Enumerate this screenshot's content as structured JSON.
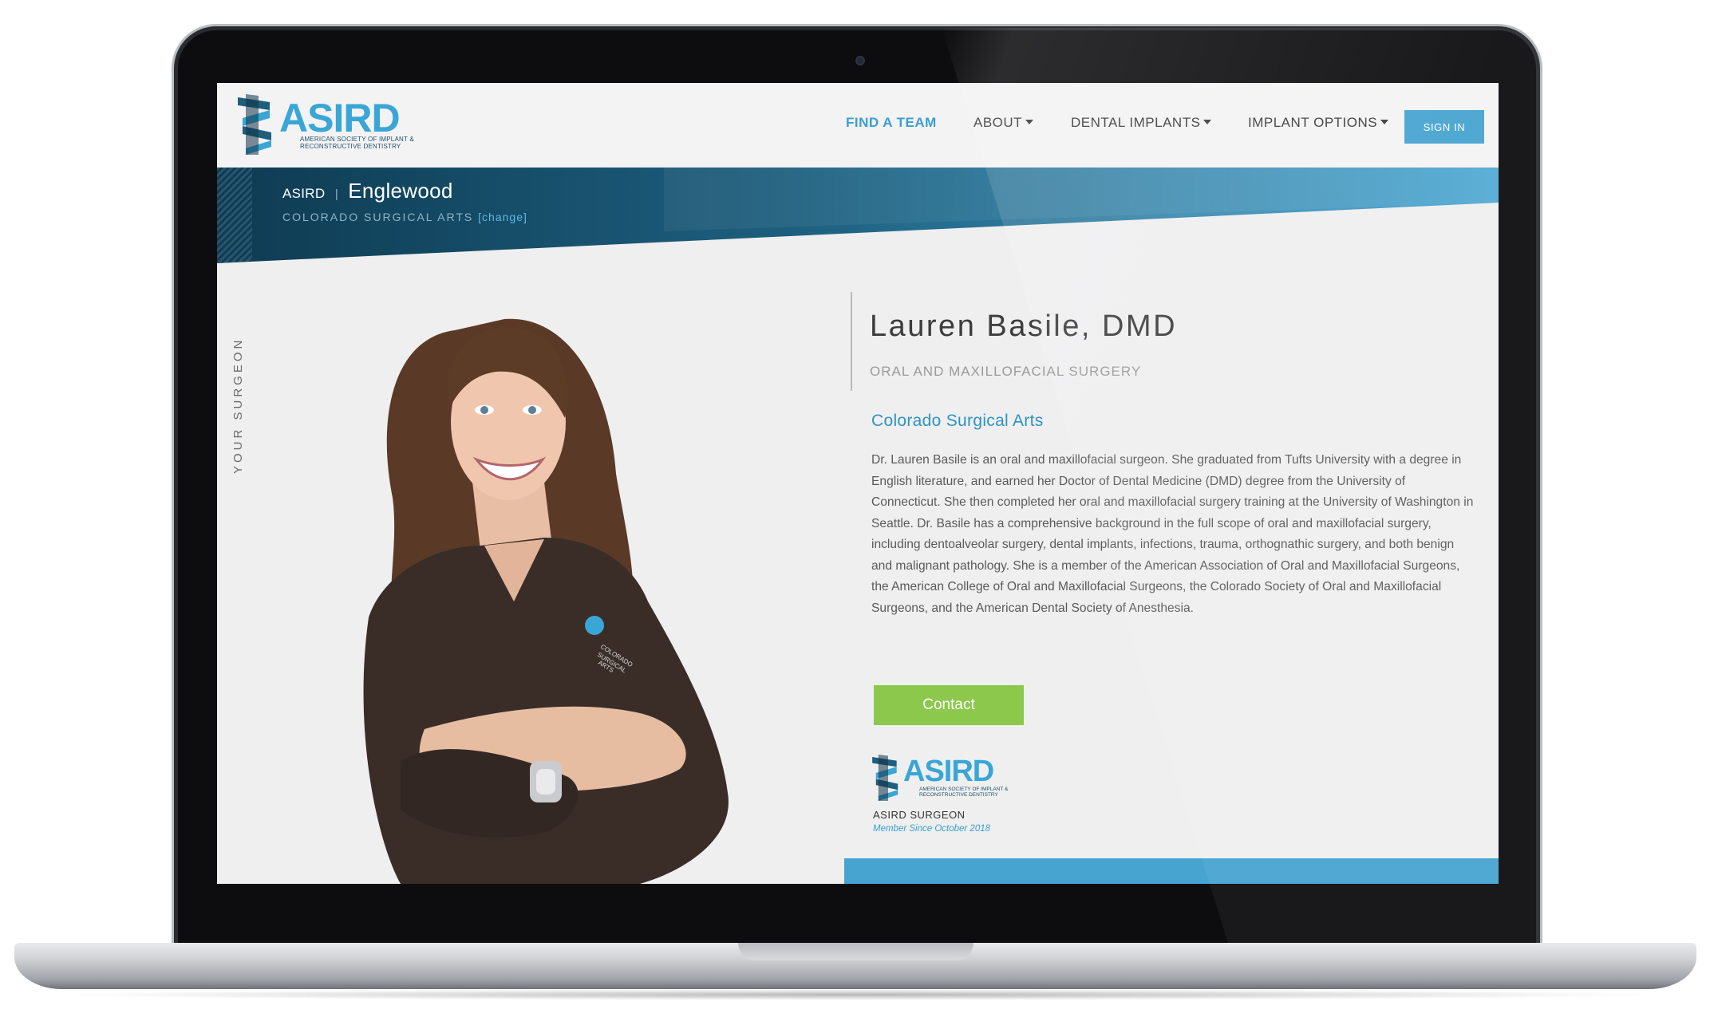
{
  "colors": {
    "accent": "#3aa6d6",
    "banner_dark": "#0f3f57",
    "banner_light": "#3f9bc8",
    "contact_green": "#8cc84b",
    "signin_blue": "#47a4d0"
  },
  "logo": {
    "word": "ASIRD",
    "subtitle": "American Society of Implant & Reconstructive Dentistry"
  },
  "nav": {
    "find_team": "FIND A TEAM",
    "about": "ABOUT",
    "dental_implants": "DENTAL IMPLANTS",
    "implant_options": "IMPLANT OPTIONS",
    "sign_in": "SIGN IN"
  },
  "banner": {
    "root": "ASIRD",
    "separator": "|",
    "city": "Englewood",
    "practice_caps": "COLORADO SURGICAL ARTS",
    "change_link": "[change]"
  },
  "side_label": "YOUR SURGEON",
  "profile": {
    "name": "Lauren Basile, DMD",
    "specialty": "ORAL AND MAXILLOFACIAL SURGERY",
    "practice": "Colorado Surgical Arts",
    "bio": "Dr. Lauren Basile is an oral and maxillofacial surgeon. She graduated from Tufts University with a degree in English literature, and earned her Doctor of Dental Medicine (DMD) degree from the University of Connecticut. She then completed her oral and maxillofacial surgery training at the University of Washington in Seattle. Dr. Basile has a comprehensive background in the full scope of oral and maxillofacial surgery, including dentoalveolar surgery, dental implants, infections, trauma, orthognathic surgery, and both benign and malignant pathology. She is a member of the American Association of Oral and Maxillofacial Surgeons, the American College of Oral and Maxillofacial Surgeons, the Colorado Society of Oral and Maxillofacial Surgeons, and the American Dental Society of Anesthesia.",
    "contact_label": "Contact"
  },
  "badge": {
    "word": "ASIRD",
    "subtitle": "American Society of Implant & Reconstructive Dentistry",
    "title": "ASIRD SURGEON",
    "member_since": "Member Since October 2018"
  },
  "scrub_logo": [
    "COLORADO",
    "SURGICAL",
    "ARTS"
  ]
}
